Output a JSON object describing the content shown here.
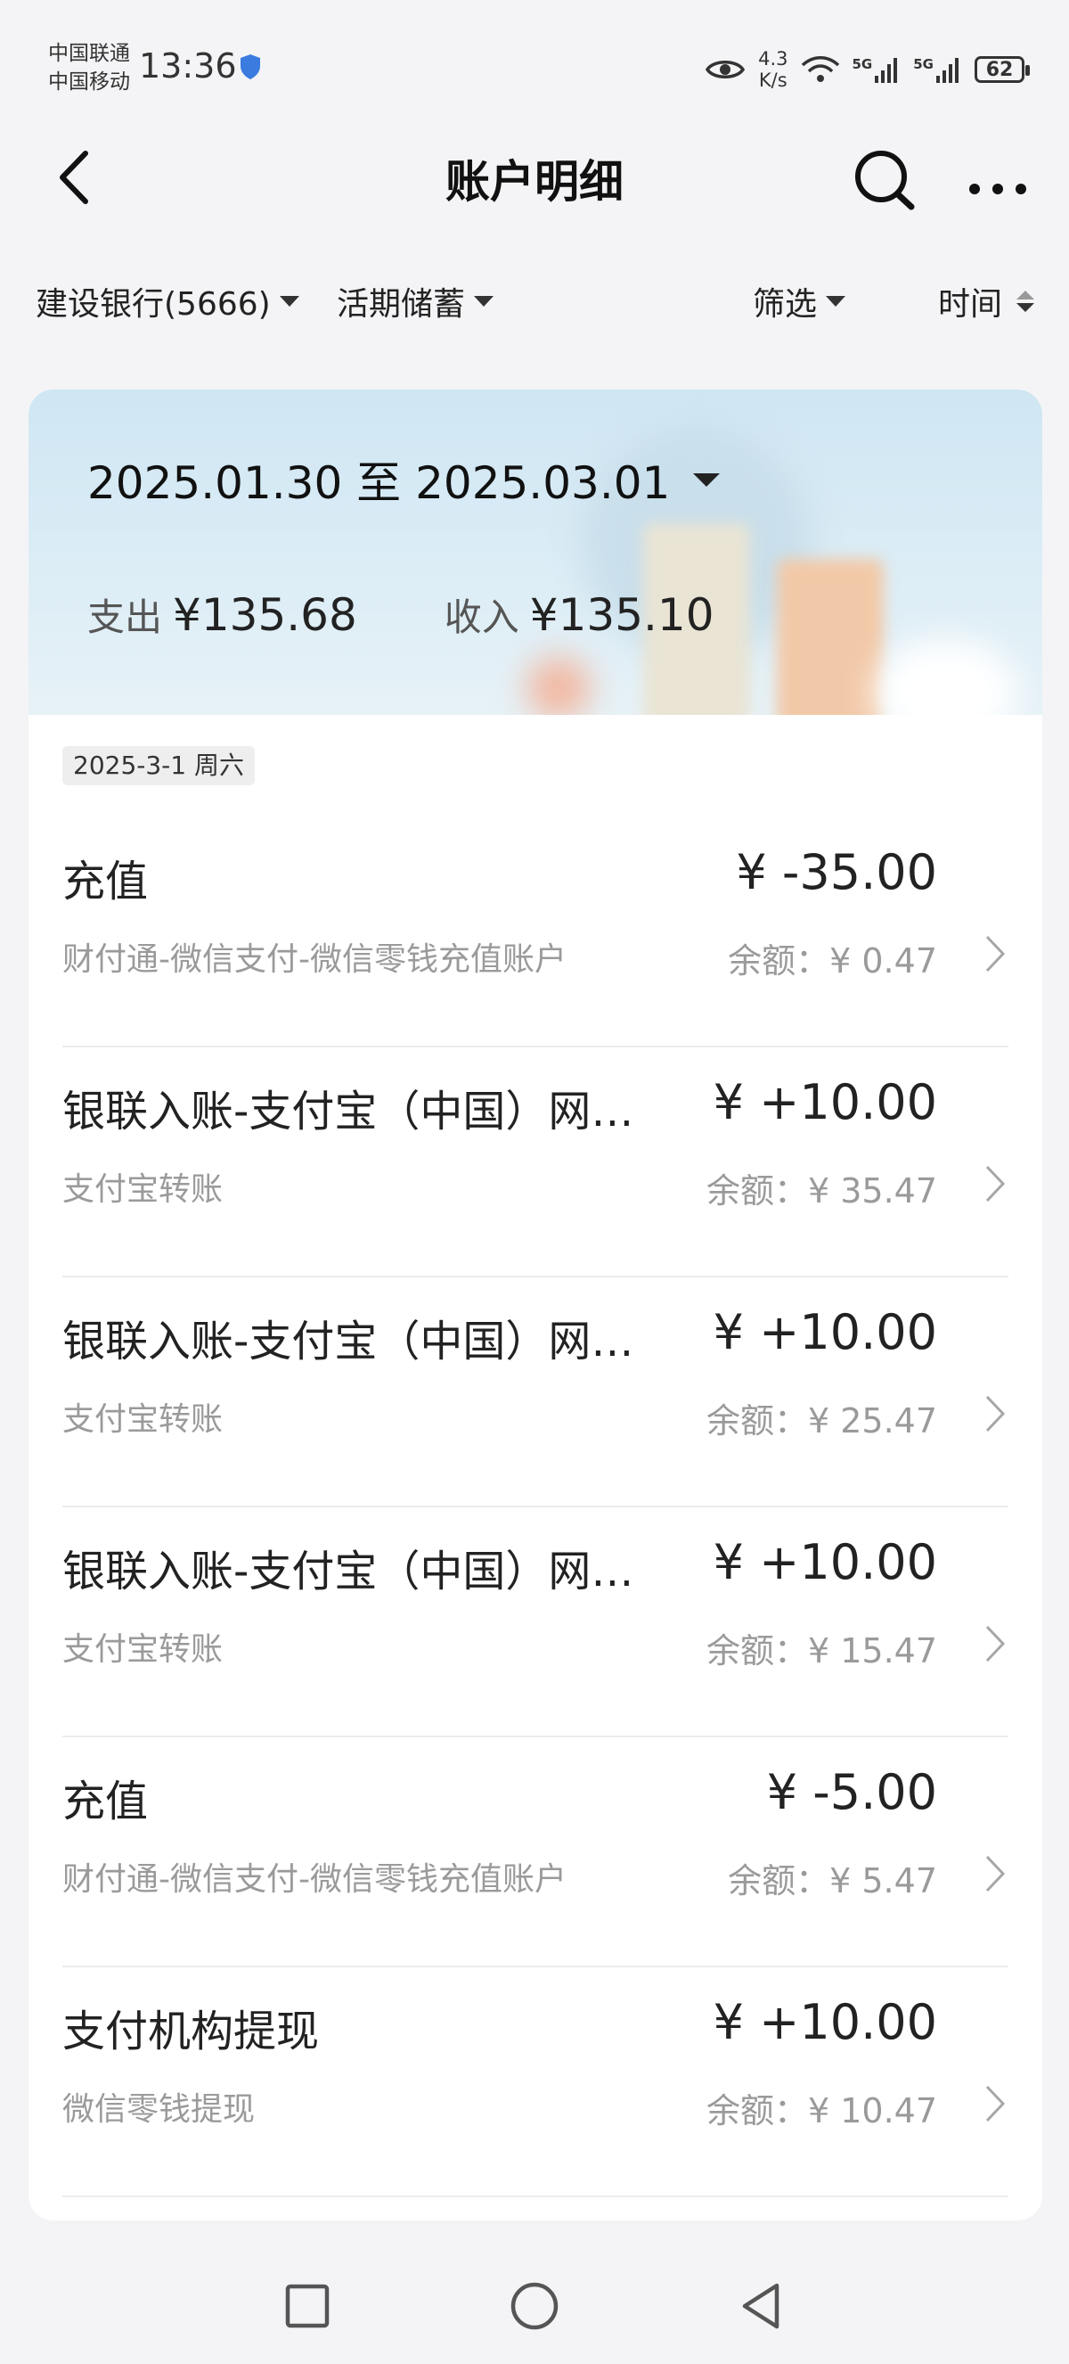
{
  "status_bar": {
    "carrier_1": "中国联通",
    "carrier_2": "中国移动",
    "time": "13:36",
    "net_speed_value": "4.3",
    "net_speed_unit": "K/s",
    "signal_1_label": "5G",
    "signal_2_label": "5G",
    "battery": "62"
  },
  "header": {
    "title": "账户明细",
    "icons": [
      "back-icon",
      "search-icon",
      "more-icon"
    ]
  },
  "filters": {
    "account": "建设银行(5666)",
    "account_type": "活期储蓄",
    "filter": "筛选",
    "sort": "时间"
  },
  "summary": {
    "date_range": "2025.01.30 至 2025.03.01",
    "expense_label": "支出",
    "expense_value": "¥135.68",
    "income_label": "收入",
    "income_value": "¥135.10"
  },
  "date_group": "2025-3-1 周六",
  "transactions": [
    {
      "title": "充值",
      "subtitle": "财付通-微信支付-微信零钱充值账户",
      "amount": "¥ -35.00",
      "balance": "余额：¥ 0.47"
    },
    {
      "title": "银联入账-支付宝（中国）网…",
      "subtitle": "支付宝转账",
      "amount": "¥ +10.00",
      "balance": "余额：¥ 35.47"
    },
    {
      "title": "银联入账-支付宝（中国）网…",
      "subtitle": "支付宝转账",
      "amount": "¥ +10.00",
      "balance": "余额：¥ 25.47"
    },
    {
      "title": "银联入账-支付宝（中国）网…",
      "subtitle": "支付宝转账",
      "amount": "¥ +10.00",
      "balance": "余额：¥ 15.47"
    },
    {
      "title": "充值",
      "subtitle": "财付通-微信支付-微信零钱充值账户",
      "amount": "¥ -5.00",
      "balance": "余额：¥ 5.47"
    },
    {
      "title": "支付机构提现",
      "subtitle": "微信零钱提现",
      "amount": "¥ +10.00",
      "balance": "余额：¥ 10.47"
    }
  ],
  "system_nav": [
    "recent-apps-icon",
    "home-icon",
    "back-triangle-icon"
  ],
  "colors": {
    "background": "#f4f4f6",
    "banner": "#d6eaf5",
    "muted_text": "#9a9a9a"
  }
}
